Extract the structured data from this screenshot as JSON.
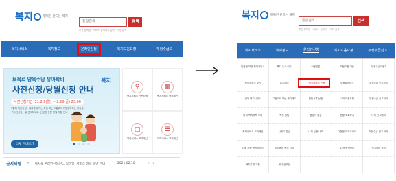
{
  "left": {
    "logo_text": "복지",
    "logo_tagline": "행복한 만드는 복지",
    "search_placeholder": "통합검색",
    "search_button": "검색",
    "search_sub": "추천 정책명 · 서비스 검색하기 입력 · 기타 검색",
    "nav": [
      "복지서비스",
      "복지정보",
      "온라인신청",
      "복지도움요청",
      "부정수급고"
    ],
    "nav_highlight_index": 2,
    "banner": {
      "small": "보육료 양육수당 유아학비",
      "big": "사전신청/당월신청 안내",
      "date": "사전신청기간 '21.2.1(월) ~ 2.26(금) 23:00",
      "desc1": "3월에 어린이집 · 유치원에 가는 아동 또는 3월부터 가정양육하는 아동은",
      "desc2": "「사전신청」을 선택하세요. 신청한 신청 당월 적용 안내",
      "button": "상세 안내보기",
      "logo": "복지"
    },
    "quick_links": [
      "복지서비스 간편검색",
      "복지서비스 모의계산",
      "복지서비스 모의계산",
      "복지서비스 모의계산"
    ],
    "notice": {
      "label": "공지사항",
      "text": "복지로 온라인신청(PC, 모바일) 서비스 일시 중단 안내",
      "date": "2021.02.10"
    }
  },
  "right": {
    "logo_text": "복지",
    "logo_tagline": "행복한 만드는 복지",
    "search_placeholder": "통합검색",
    "search_button": "검색",
    "search_sub": "추천 정책명 · 서비스 검색 이 · 기타 검색",
    "nav": [
      "복지서비스",
      "복지정보",
      "온라인신청",
      "복지도움요청",
      "부정수급신고"
    ],
    "columns": [
      [
        "맞춤형 보건 복지서비스",
        "복지서비스 찾기",
        "생애 복지서비스",
        "나의 복지혜택 조회",
        "복지서비스 모의계산",
        "나를 위한 복지서비스",
        "복지주제 개편"
      ],
      [
        "복지 뉴스·이슈",
        "뉴스레터",
        "그림으로 보는 복지제도",
        "복지 칼럼",
        "사례로 접근",
        "우리동네 복지 사업",
        "복지 공모전"
      ],
      [
        "이용방법",
        "복지서비스 신청",
        "민원서류 신청",
        "증명서 발급",
        "나의 신청 내역",
        "",
        ""
      ],
      [
        "도움요청 기능",
        "도움요청하기",
        "나의 도움요청",
        "현황 조회하기",
        "이웃을 도와주세요",
        "129 복지상담",
        ""
      ],
      [
        "부정수급이란?",
        "부정수급 신고방법",
        "부정수급 신고하기",
        "나의 신고내역",
        "부정수급 신고 사례",
        "신고사례 보상",
        ""
      ]
    ],
    "active_cell": "복지서비스 신청"
  }
}
